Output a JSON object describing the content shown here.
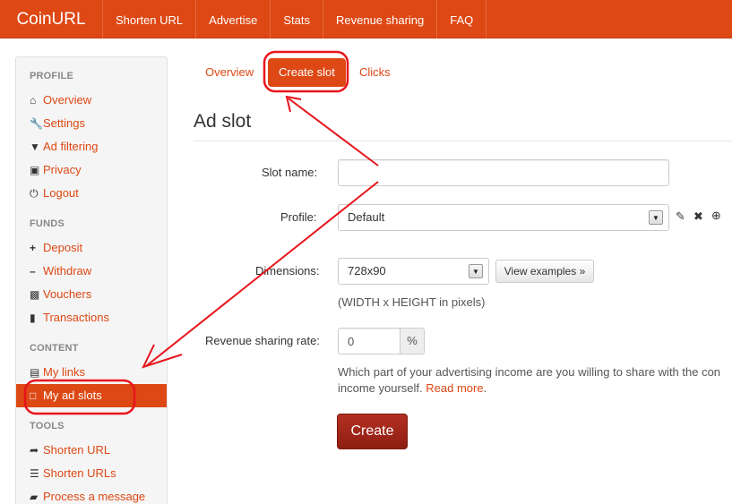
{
  "brand": "CoinURL",
  "nav": [
    "Shorten URL",
    "Advertise",
    "Stats",
    "Revenue sharing",
    "FAQ"
  ],
  "sidebar": {
    "sections": [
      {
        "title": "PROFILE",
        "items": [
          {
            "label": "Overview",
            "icon": "home-icon"
          },
          {
            "label": "Settings",
            "icon": "wrench-icon"
          },
          {
            "label": "Ad filtering",
            "icon": "filter-icon"
          },
          {
            "label": "Privacy",
            "icon": "lock-icon"
          },
          {
            "label": "Logout",
            "icon": "power-icon"
          }
        ]
      },
      {
        "title": "FUNDS",
        "items": [
          {
            "label": "Deposit",
            "icon": "plus-icon"
          },
          {
            "label": "Withdraw",
            "icon": "minus-icon"
          },
          {
            "label": "Vouchers",
            "icon": "gift-icon"
          },
          {
            "label": "Transactions",
            "icon": "book-icon"
          }
        ]
      },
      {
        "title": "CONTENT",
        "items": [
          {
            "label": "My links",
            "icon": "list-icon"
          },
          {
            "label": "My ad slots",
            "icon": "file-icon",
            "active": true
          }
        ]
      },
      {
        "title": "TOOLS",
        "items": [
          {
            "label": "Shorten URL",
            "icon": "share-icon"
          },
          {
            "label": "Shorten URLs",
            "icon": "list-icon"
          },
          {
            "label": "Process a message",
            "icon": "comment-icon"
          }
        ]
      }
    ]
  },
  "tabs": [
    {
      "label": "Overview"
    },
    {
      "label": "Create slot",
      "active": true
    },
    {
      "label": "Clicks"
    }
  ],
  "form": {
    "title": "Ad slot",
    "slot_name_label": "Slot name:",
    "slot_name_value": "",
    "profile_label": "Profile:",
    "profile_value": "Default",
    "dimensions_label": "Dimensions:",
    "dimensions_value": "728x90",
    "view_examples": "View examples »",
    "dimensions_help": "(WIDTH x HEIGHT in pixels)",
    "revenue_label": "Revenue sharing rate:",
    "revenue_value": "0",
    "revenue_unit": "%",
    "revenue_help_line1": "Which part of your advertising income are you willing to share with the con",
    "revenue_help_line2": "income yourself.",
    "read_more": "Read more",
    "revenue_help_end": ".",
    "create_button": "Create"
  },
  "colors": {
    "brand": "#dd4814",
    "annotation": "#e8141b",
    "create_button": "#a52a1c"
  }
}
